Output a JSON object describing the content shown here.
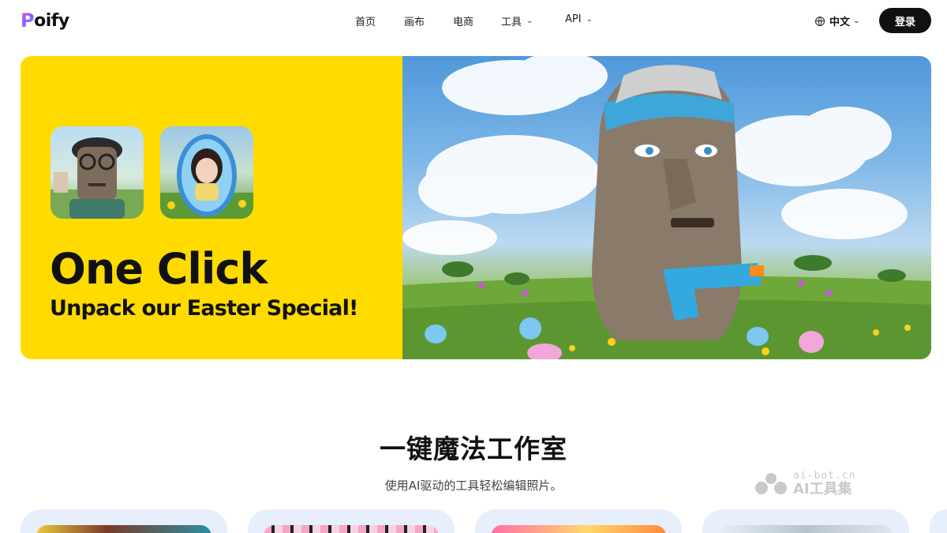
{
  "header": {
    "logo_initial": "P",
    "logo_rest": "oify",
    "nav": [
      {
        "label": "首页",
        "has_dropdown": false
      },
      {
        "label": "画布",
        "has_dropdown": false
      },
      {
        "label": "电商",
        "has_dropdown": false
      },
      {
        "label": "工具",
        "has_dropdown": true
      },
      {
        "label": "API",
        "has_dropdown": true
      }
    ],
    "language": "中文",
    "login_label": "登录"
  },
  "hero": {
    "title": "One Click",
    "subtitle": "Unpack our Easter Special!"
  },
  "section": {
    "title": "一键魔法工作室",
    "subtitle": "使用AI驱动的工具轻松编辑照片。"
  },
  "watermark": {
    "url": "ai-bot.cn",
    "name": "AI工具集"
  },
  "colors": {
    "banner_yellow": "#ffdb00",
    "login_button": "#111111",
    "card_bg": "#e8effc"
  }
}
